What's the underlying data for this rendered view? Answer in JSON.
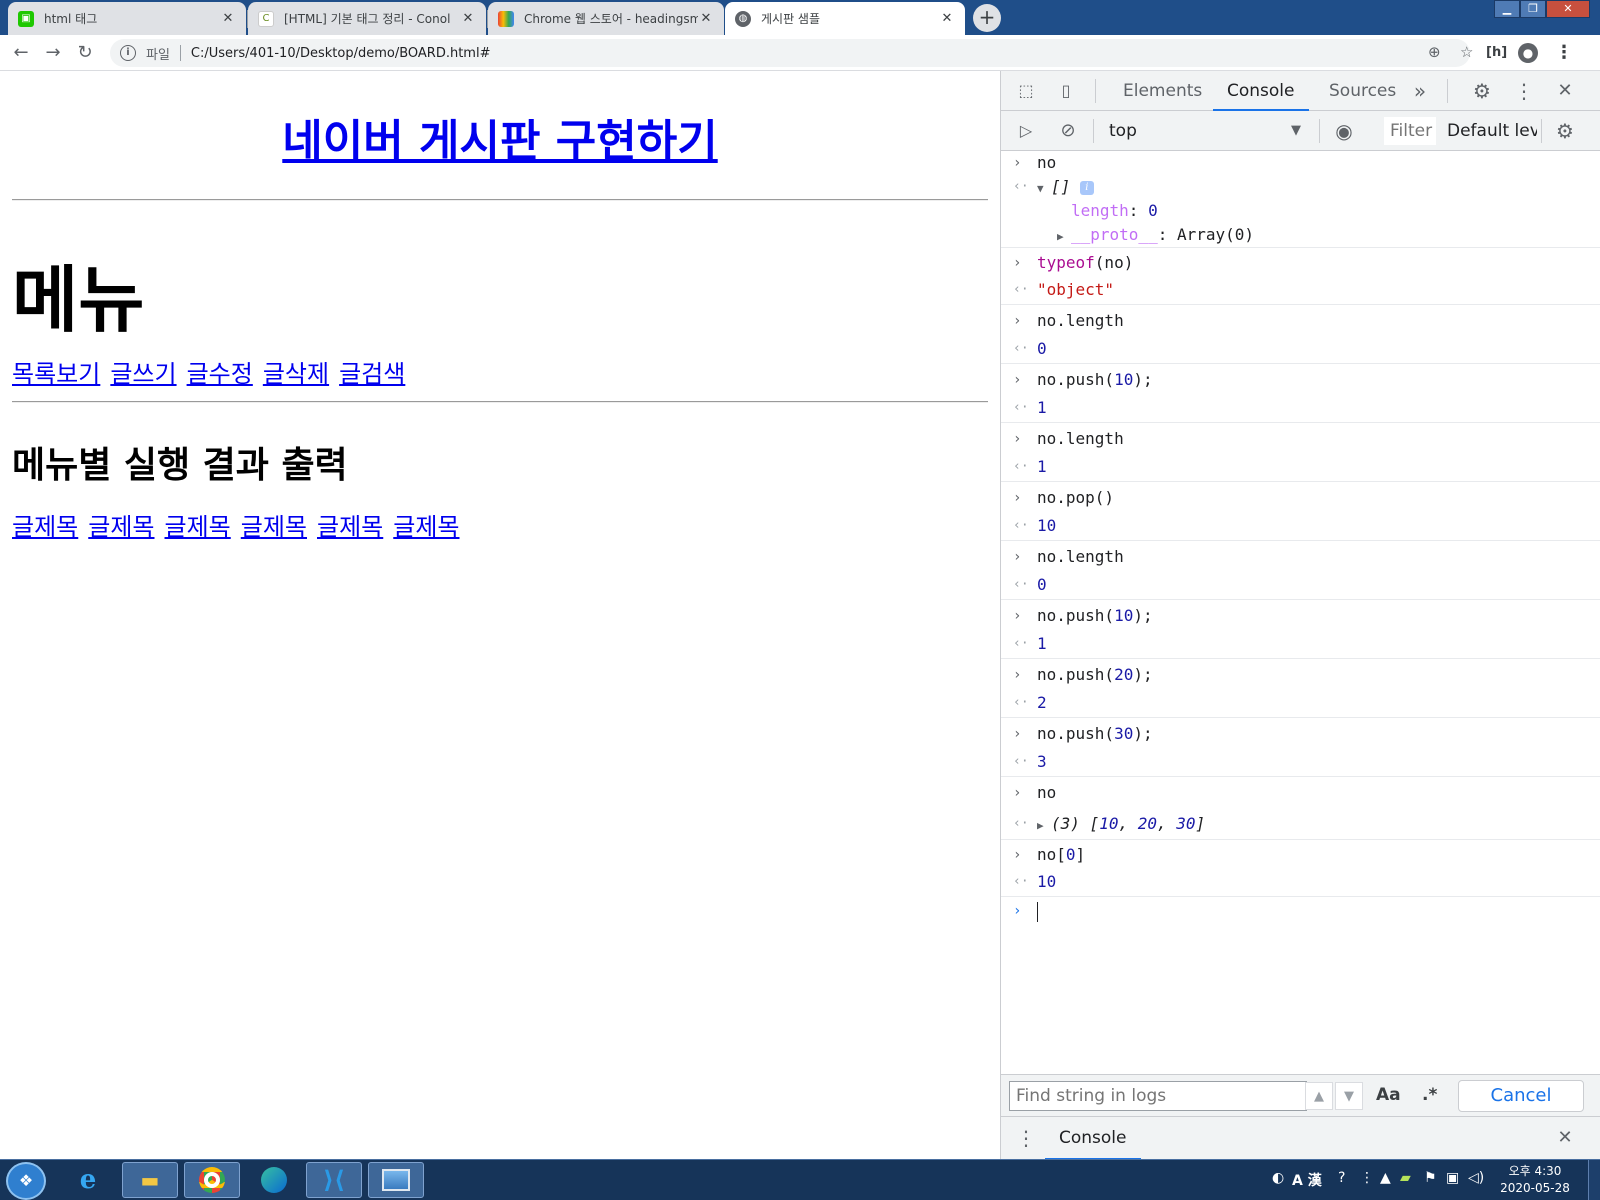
{
  "browser": {
    "tabs": [
      {
        "label": "html 태그",
        "icon": "naver-favicon"
      },
      {
        "label": "[HTML] 기본 태그 정리 - Conol",
        "icon": "site-favicon"
      },
      {
        "label": "Chrome 웹 스토어 - headingsm",
        "icon": "chrome-webstore-icon"
      },
      {
        "label": "게시판 샘플",
        "icon": "globe-icon"
      }
    ],
    "active_tab_index": 3,
    "address": {
      "scheme_label": "파일",
      "url": "C:/Users/401-10/Desktop/demo/BOARD.html#"
    }
  },
  "page": {
    "title": "네이버 게시판 구현하기",
    "menu_heading": "메뉴",
    "menu_links": [
      "목록보기",
      "글쓰기",
      "글수정",
      "글삭제",
      "글검색"
    ],
    "result_heading": "메뉴별 실행 결과 출력",
    "result_links": [
      "글제목",
      "글제목",
      "글제목",
      "글제목",
      "글제목",
      "글제목"
    ]
  },
  "devtools": {
    "tabs": [
      "Elements",
      "Console",
      "Sources"
    ],
    "active_tab": "Console",
    "more_tabs_glyph": "»",
    "context": "top",
    "filter_placeholder": "Filter",
    "levels": "Default levels",
    "console": {
      "entry_1": {
        "input": "no",
        "output_bracket": "[]",
        "info_badge": "i",
        "length_key": "length",
        "length_value": "0",
        "proto_key": "__proto__",
        "proto_value": "Array(0)"
      },
      "entry_2": {
        "fn": "typeof",
        "arg": "(no)",
        "output": "\"object\""
      },
      "entry_3": {
        "input": "no.length",
        "output": "0"
      },
      "entry_4": {
        "input_pre": "no.push(",
        "arg": "10",
        "input_post": ");",
        "output": "1"
      },
      "entry_5": {
        "input": "no.length",
        "output": "1"
      },
      "entry_6": {
        "input": "no.pop()",
        "output": "10"
      },
      "entry_7": {
        "input": "no.length",
        "output": "0"
      },
      "entry_8": {
        "input_pre": "no.push(",
        "arg": "10",
        "input_post": ");",
        "output": "1"
      },
      "entry_9": {
        "input_pre": "no.push(",
        "arg": "20",
        "input_post": ");",
        "output": "2"
      },
      "entry_10": {
        "input_pre": "no.push(",
        "arg": "30",
        "input_post": ");",
        "output": "3"
      },
      "entry_11": {
        "input": "no",
        "count": "(3)",
        "open": "[",
        "v1": "10",
        "v2": "20",
        "v3": "30",
        "close": "]"
      },
      "entry_12": {
        "input_pre": "no[",
        "arg": "0",
        "input_post": "]",
        "output": "10"
      }
    },
    "search": {
      "placeholder": "Find string in logs",
      "case_label": "Aa",
      "regex_label": ".*",
      "cancel_label": "Cancel"
    },
    "drawer_tab": "Console"
  },
  "taskbar": {
    "apps": [
      "internet-explorer-icon",
      "file-explorer-icon",
      "chrome-icon",
      "edge-icon",
      "vscode-icon",
      "image-viewer-icon"
    ],
    "ime_label": "A 漢",
    "clock_time": "오후 4:30",
    "clock_date": "2020-05-28"
  }
}
